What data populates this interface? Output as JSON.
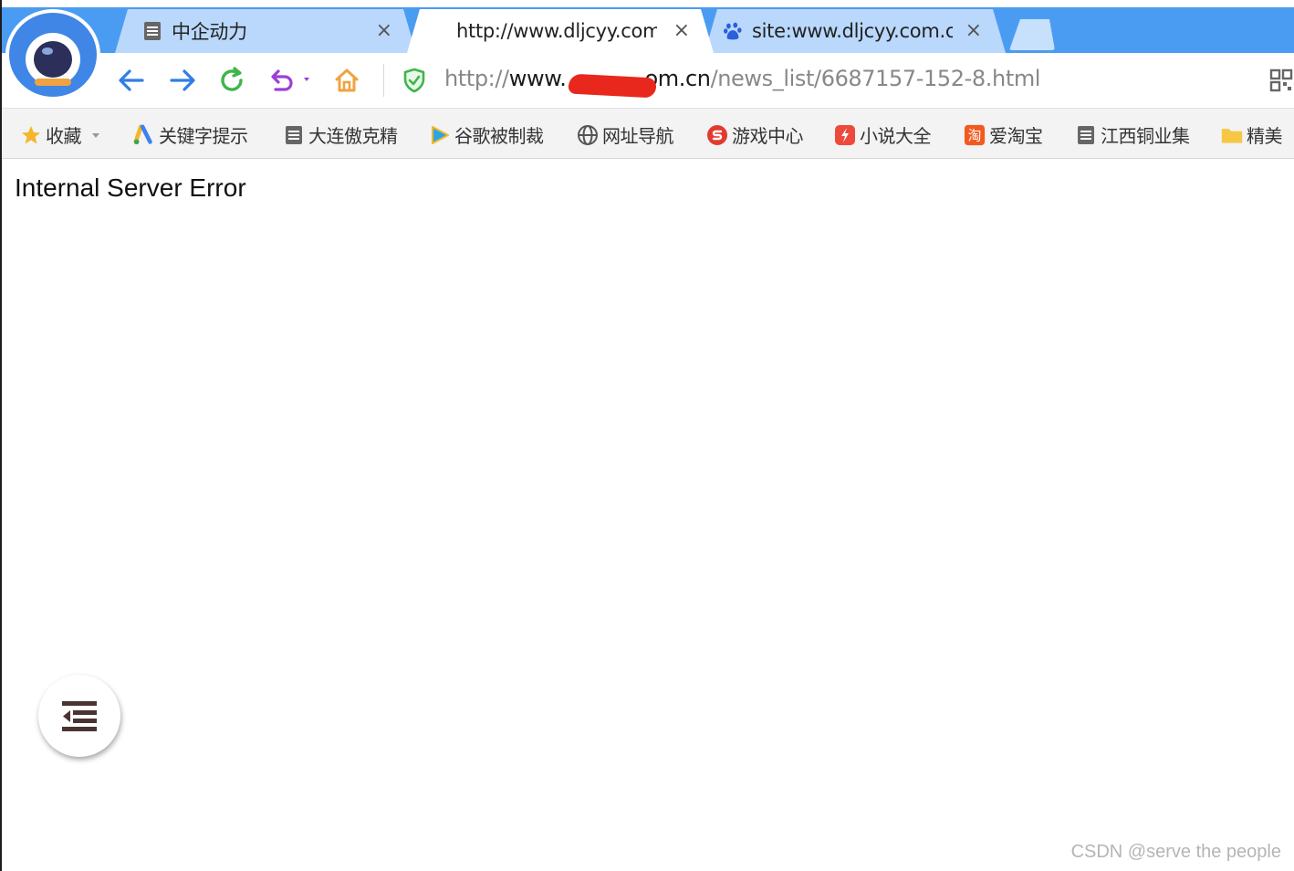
{
  "tabs": [
    {
      "title": "中企动力",
      "close": "×",
      "icon": "page-icon"
    },
    {
      "title": "http://www.dljcyy.com.",
      "close": "×",
      "icon": "none"
    },
    {
      "title": "site:www.dljcyy.com.cn",
      "close": "×",
      "icon": "baidu-paw-icon"
    }
  ],
  "toolbar": {
    "url_prefix": "http://",
    "url_host_start": "www.",
    "url_host_end": "om.cn",
    "url_path": "/news_list/6687157-152-8.html"
  },
  "bookmarks": [
    {
      "label": "收藏",
      "icon": "star-icon"
    },
    {
      "label": "关键字提示",
      "icon": "google-ads-icon"
    },
    {
      "label": "大连傲克精",
      "icon": "page-icon"
    },
    {
      "label": "谷歌被制裁",
      "icon": "play-icon"
    },
    {
      "label": "网址导航",
      "icon": "globe-icon"
    },
    {
      "label": "游戏中心",
      "icon": "game-icon"
    },
    {
      "label": "小说大全",
      "icon": "novel-icon"
    },
    {
      "label": "爱淘宝",
      "icon": "taobao-icon"
    },
    {
      "label": "江西铜业集",
      "icon": "page-icon"
    },
    {
      "label": "精美",
      "icon": "folder-icon"
    }
  ],
  "content": {
    "message": "Internal Server Error"
  },
  "watermark": "CSDN @serve the people",
  "colors": {
    "tabstrip": "#4a9cf2",
    "inactive_tab": "#b9d8fb",
    "accent_blue": "#2f7ee8",
    "reload_green": "#3fb54a",
    "undo_purple": "#9b3fd6",
    "home_orange": "#f0a340",
    "redaction": "#e8281c"
  }
}
